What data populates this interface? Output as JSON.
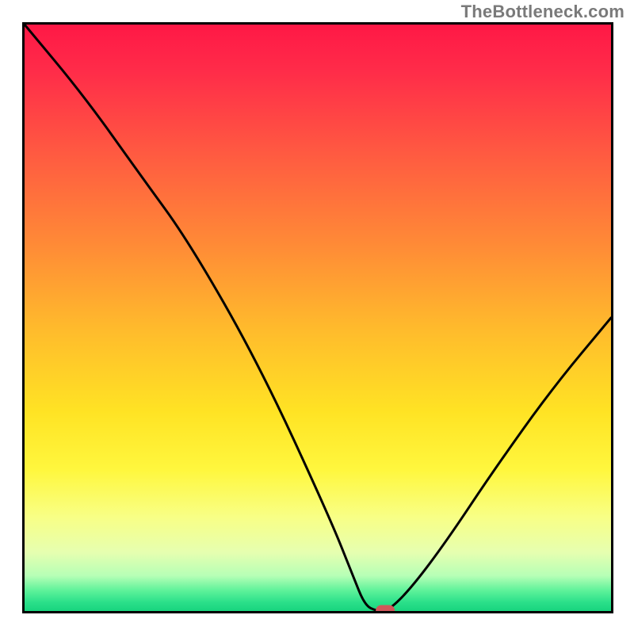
{
  "watermark": {
    "text": "TheBottleneck.com"
  },
  "chart_data": {
    "type": "line",
    "title": "",
    "xlabel": "",
    "ylabel": "",
    "xlim": [
      0,
      100
    ],
    "ylim": [
      0,
      100
    ],
    "legend": false,
    "grid": false,
    "series": [
      {
        "name": "bottleneck-curve",
        "x": [
          0,
          10,
          20,
          28,
          40,
          52,
          56,
          58,
          60,
          62,
          66,
          72,
          80,
          90,
          100
        ],
        "values": [
          100,
          88,
          74,
          63,
          42,
          16,
          6,
          1,
          0,
          0,
          4,
          12,
          24,
          38,
          50
        ]
      }
    ],
    "marker": {
      "name": "optimal-point",
      "x": 61.5,
      "y": 0,
      "color": "#d0565a"
    },
    "background": {
      "stops": [
        {
          "pos": 0.0,
          "color": "#ff1846"
        },
        {
          "pos": 0.08,
          "color": "#ff2c49"
        },
        {
          "pos": 0.22,
          "color": "#ff5a41"
        },
        {
          "pos": 0.38,
          "color": "#ff8c36"
        },
        {
          "pos": 0.52,
          "color": "#ffbb2c"
        },
        {
          "pos": 0.66,
          "color": "#ffe324"
        },
        {
          "pos": 0.76,
          "color": "#fff73e"
        },
        {
          "pos": 0.84,
          "color": "#f8ff86"
        },
        {
          "pos": 0.9,
          "color": "#e6ffb0"
        },
        {
          "pos": 0.94,
          "color": "#b6ffb6"
        },
        {
          "pos": 0.965,
          "color": "#5ef29a"
        },
        {
          "pos": 0.985,
          "color": "#2be08a"
        },
        {
          "pos": 1.0,
          "color": "#18d47e"
        }
      ]
    },
    "frame_color": "#000000",
    "line_color": "#000000"
  }
}
